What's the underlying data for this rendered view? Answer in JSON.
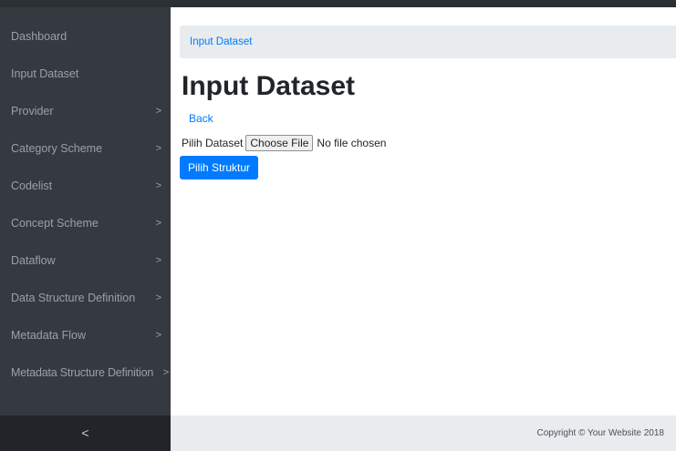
{
  "sidebar": {
    "items": [
      {
        "label": "Dashboard",
        "has_chevron": false
      },
      {
        "label": "Input Dataset",
        "has_chevron": false
      },
      {
        "label": "Provider",
        "has_chevron": true
      },
      {
        "label": "Category Scheme",
        "has_chevron": true
      },
      {
        "label": "Codelist",
        "has_chevron": true
      },
      {
        "label": "Concept Scheme",
        "has_chevron": true
      },
      {
        "label": "Dataflow",
        "has_chevron": true
      },
      {
        "label": "Data Structure Definition",
        "has_chevron": true
      },
      {
        "label": "Metadata Flow",
        "has_chevron": true
      },
      {
        "label": "Metadata Structure Definition",
        "has_chevron": true
      }
    ],
    "chevron_glyph": ">",
    "collapse_glyph": "<"
  },
  "breadcrumb": {
    "label": "Input Dataset"
  },
  "main": {
    "title": "Input Dataset",
    "back_label": "Back",
    "file_label": "Pilih Dataset",
    "file_button_label": "Choose File",
    "file_status": "No file chosen",
    "submit_label": "Pilih Struktur"
  },
  "footer": {
    "copyright": "Copyright © Your Website 2018"
  },
  "colors": {
    "sidebar_bg": "#343a40",
    "accent": "#007bff",
    "light_bg": "#e9ecef"
  }
}
